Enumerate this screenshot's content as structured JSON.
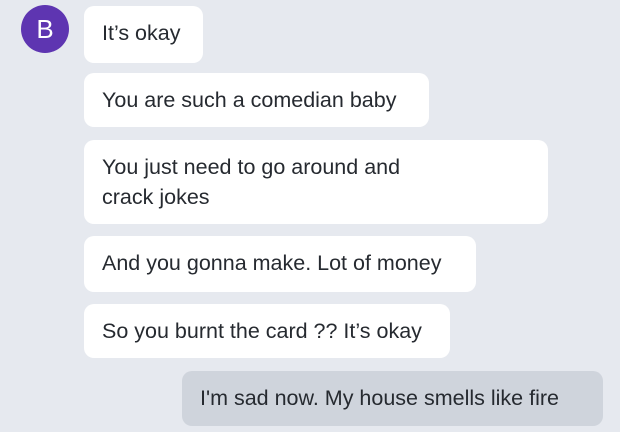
{
  "contact": {
    "avatar_initial": "B",
    "avatar_color": "#5e35b1"
  },
  "colors": {
    "background": "#e6e9ef",
    "incoming_bubble": "#ffffff",
    "outgoing_bubble": "#cfd4dc",
    "text": "#262a30"
  },
  "messages": [
    {
      "direction": "incoming",
      "text": "It’s okay"
    },
    {
      "direction": "incoming",
      "text": "You are such a comedian baby"
    },
    {
      "direction": "incoming",
      "text": "You just need to go around and\ncrack jokes"
    },
    {
      "direction": "incoming",
      "text": "And you gonna make. Lot of money"
    },
    {
      "direction": "incoming",
      "text": "So you burnt the card ?? It’s okay"
    },
    {
      "direction": "outgoing",
      "text": "I'm sad now. My house smells like fire"
    }
  ]
}
